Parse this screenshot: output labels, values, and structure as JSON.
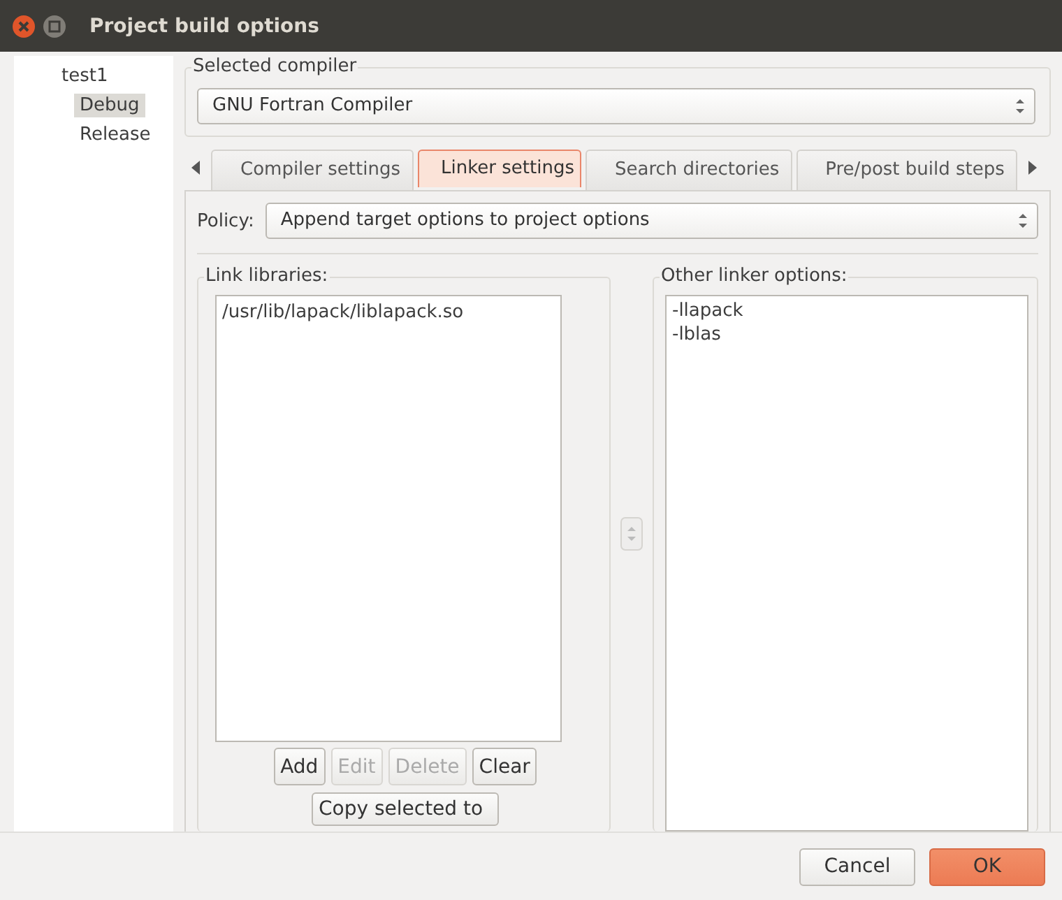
{
  "window": {
    "title": "Project build options"
  },
  "tree": [
    {
      "label": "test1",
      "selected": false,
      "children": [
        {
          "label": "Debug",
          "selected": true
        },
        {
          "label": "Release",
          "selected": false
        }
      ]
    }
  ],
  "compiler": {
    "label": "Selected compiler",
    "value": "GNU Fortran Compiler"
  },
  "tabs": [
    {
      "label": "Compiler settings",
      "selected": false
    },
    {
      "label": "Linker settings",
      "selected": true
    },
    {
      "label": "Search directories",
      "selected": false
    },
    {
      "label": "Pre/post build steps",
      "selected": false
    }
  ],
  "policy": {
    "label": "Policy:",
    "value": "Append target options to project options"
  },
  "link_libraries": {
    "label": "Link libraries:",
    "items": [
      "/usr/lib/lapack/liblapack.so"
    ],
    "buttons": [
      {
        "label": "Add",
        "disabled": false
      },
      {
        "label": "Edit",
        "disabled": true
      },
      {
        "label": "Delete",
        "disabled": true
      },
      {
        "label": "Clear",
        "disabled": false
      }
    ],
    "copy_button": "Copy selected to"
  },
  "other_linker_options": {
    "label": "Other linker options:",
    "text": "-llapack\n-lblas"
  },
  "buttons": [
    {
      "label": "Cancel",
      "kind": "normal"
    },
    {
      "label": "OK",
      "kind": "default"
    }
  ]
}
